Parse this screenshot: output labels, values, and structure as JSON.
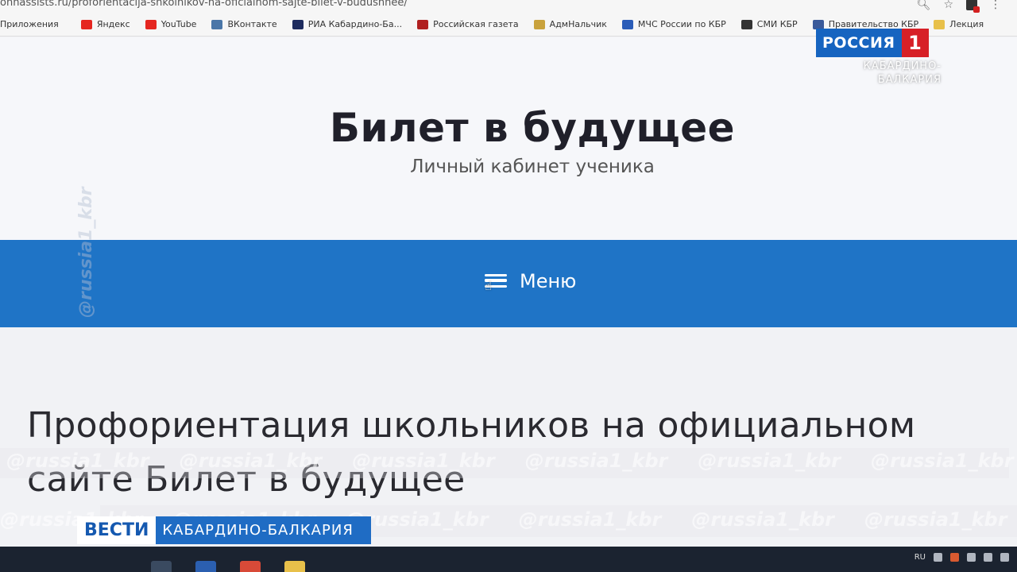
{
  "browser": {
    "url": "ohnassists.ru/proforientacija-shkolnikov-na-oficialnom-sajte-bilet-v-budushhee/",
    "bookmarks": [
      {
        "label": "Приложения",
        "icon": "apps-grid-icon",
        "color": "#4a7bd0"
      },
      {
        "label": "Яндекс",
        "icon": "yandex-icon",
        "color": "#e52620"
      },
      {
        "label": "YouTube",
        "icon": "youtube-icon",
        "color": "#e52620"
      },
      {
        "label": "ВКонтакте",
        "icon": "vk-icon",
        "color": "#4a76a8"
      },
      {
        "label": "РИА Кабардино-Ба...",
        "icon": "ria-icon",
        "color": "#1d2b5e"
      },
      {
        "label": "Российская газета",
        "icon": "rg-icon",
        "color": "#b02020"
      },
      {
        "label": "АдмНальчик",
        "icon": "emblem-icon",
        "color": "#c9a23c"
      },
      {
        "label": "МЧС России по КБР",
        "icon": "mchs-icon",
        "color": "#2a5cb8"
      },
      {
        "label": "СМИ КБР",
        "icon": "pen-icon",
        "color": "#333333"
      },
      {
        "label": "Правительство КБР",
        "icon": "gov-icon",
        "color": "#3a5a9a"
      },
      {
        "label": "Лекция",
        "icon": "folder-icon",
        "color": "#e8c04a"
      }
    ]
  },
  "site": {
    "title": "Билет в будущее",
    "subtitle": "Личный кабинет ученика",
    "menu_label": "Меню",
    "article_title": "Профориентация школьников на официальном сайте Билет в будущее"
  },
  "overlay": {
    "watermark": "@russia1_kbr",
    "channel_name": "РОССИЯ",
    "channel_number": "1",
    "channel_region": "КАБАРДИНО-БАЛКАРИЯ",
    "lower_third_brand": "ВЕСТИ",
    "lower_third_region": "КАБАРДИНО-БАЛКАРИЯ"
  },
  "taskbar": {
    "language": "RU"
  },
  "colors": {
    "menu_blue": "#1f74c6",
    "tv_blue": "#1664c0",
    "tv_red": "#d72027"
  }
}
